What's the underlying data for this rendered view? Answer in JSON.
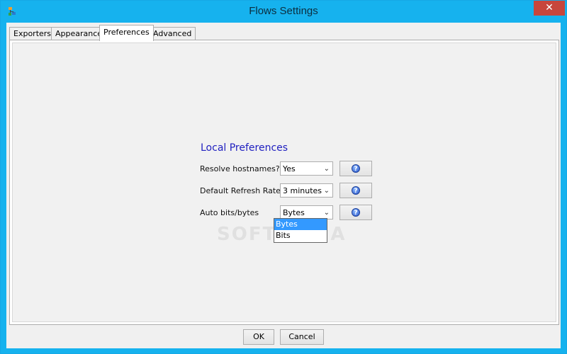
{
  "window": {
    "title": "Flows Settings",
    "close_glyph": "✕"
  },
  "tabs": [
    {
      "label": "Exporters",
      "active": false
    },
    {
      "label": "Appearance",
      "active": false
    },
    {
      "label": "Preferences",
      "active": true
    },
    {
      "label": "Advanced",
      "active": false
    }
  ],
  "preferences": {
    "section_title": "Local Preferences",
    "rows": [
      {
        "label": "Resolve hostnames?",
        "value": "Yes"
      },
      {
        "label": "Default Refresh Rate",
        "value": "3 minutes"
      },
      {
        "label": "Auto bits/bytes",
        "value": "Bytes"
      }
    ],
    "help_icon": "?",
    "dropdown_options": [
      "Bytes",
      "Bits"
    ],
    "dropdown_selected": "Bytes"
  },
  "footer": {
    "ok_label": "OK",
    "cancel_label": "Cancel"
  },
  "watermark": "SOFTPEDIA",
  "colors": {
    "titlebar": "#16b2ee",
    "close": "#c7463c",
    "section_title": "#2020c0",
    "selection": "#3399ff"
  }
}
